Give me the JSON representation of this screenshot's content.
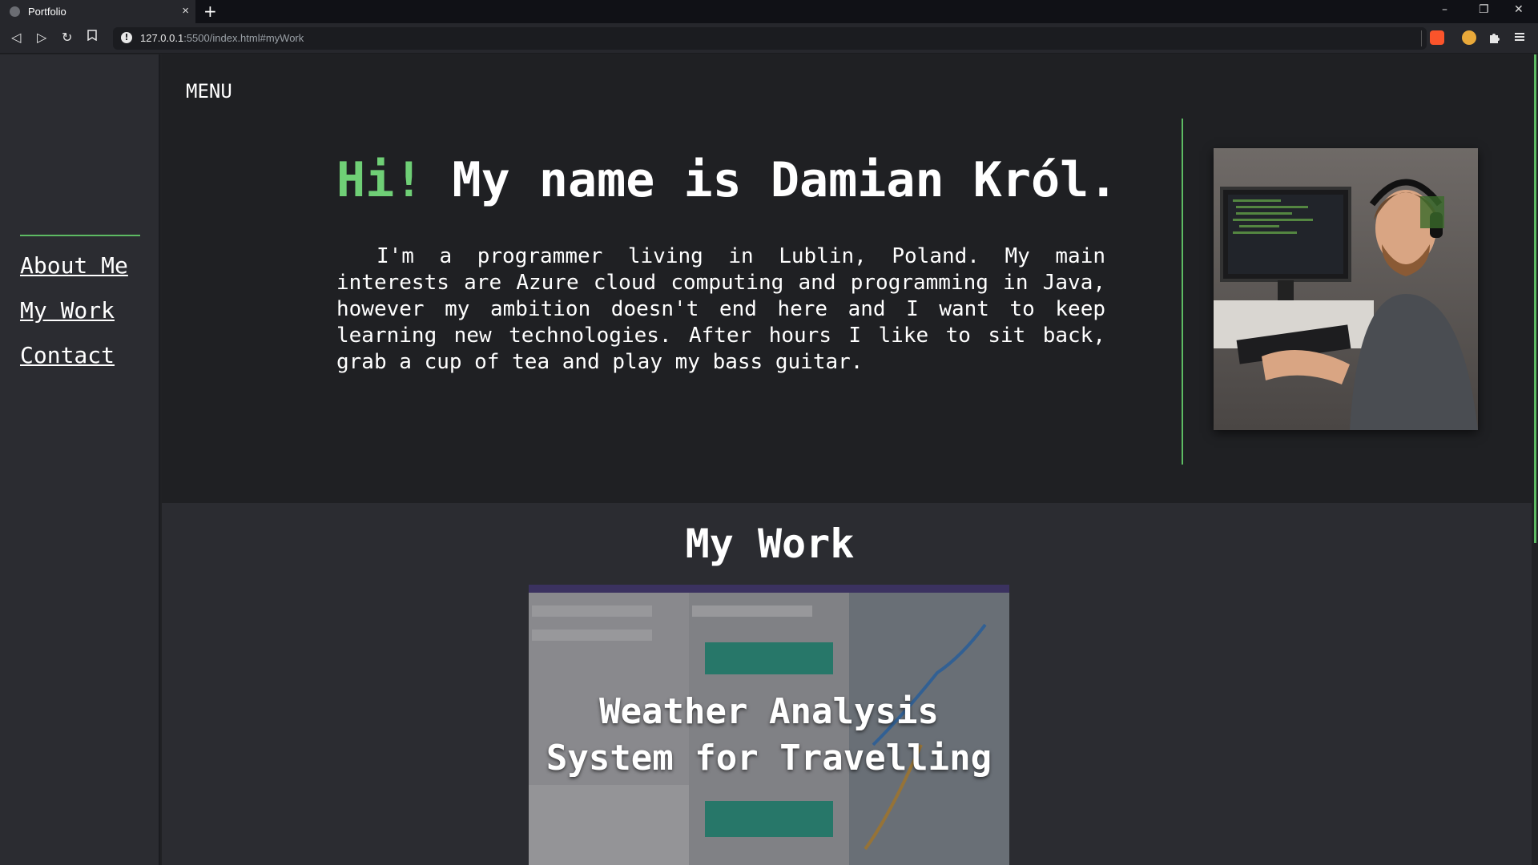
{
  "browser": {
    "tab_title": "Portfolio",
    "tab_close": "×",
    "new_tab": "+",
    "url_host": "127.0.0.1",
    "url_rest": ":5500/index.html#myWork",
    "window_controls": {
      "minimize": "–",
      "restore": "❐",
      "close": "✕"
    },
    "nav": {
      "back": "◁",
      "forward": "▷",
      "reload": "↻",
      "bookmark": "🔖"
    }
  },
  "sidebar": {
    "links": [
      {
        "label": "About Me"
      },
      {
        "label": "My Work"
      },
      {
        "label": "Contact"
      }
    ]
  },
  "header": {
    "menu_label": "MENU"
  },
  "hero": {
    "greeting": "Hi!",
    "title": " My name is Damian Król.",
    "intro": "I'm a programmer living in Lublin, Poland. My main interests are Azure cloud computing and programming in Java, however my ambition doesn't end here and I want to keep learning new technologies. After hours I like to sit back, grab a cup of tea and play my bass guitar."
  },
  "work": {
    "section_title": "My Work",
    "projects": [
      {
        "title_line1": "Weather Analysis",
        "title_line2": "System for Travelling"
      }
    ]
  },
  "colors": {
    "accent": "#5dbb63",
    "greeting": "#6fcf76",
    "sidebar_bg": "#2b2c31",
    "main_bg": "#1f2023"
  },
  "icons": [
    "tab-favicon-icon",
    "back-icon",
    "forward-icon",
    "reload-icon",
    "bookmark-icon",
    "site-info-icon",
    "brave-shield-icon",
    "extension-icon",
    "puzzle-icon",
    "hamburger-icon"
  ]
}
